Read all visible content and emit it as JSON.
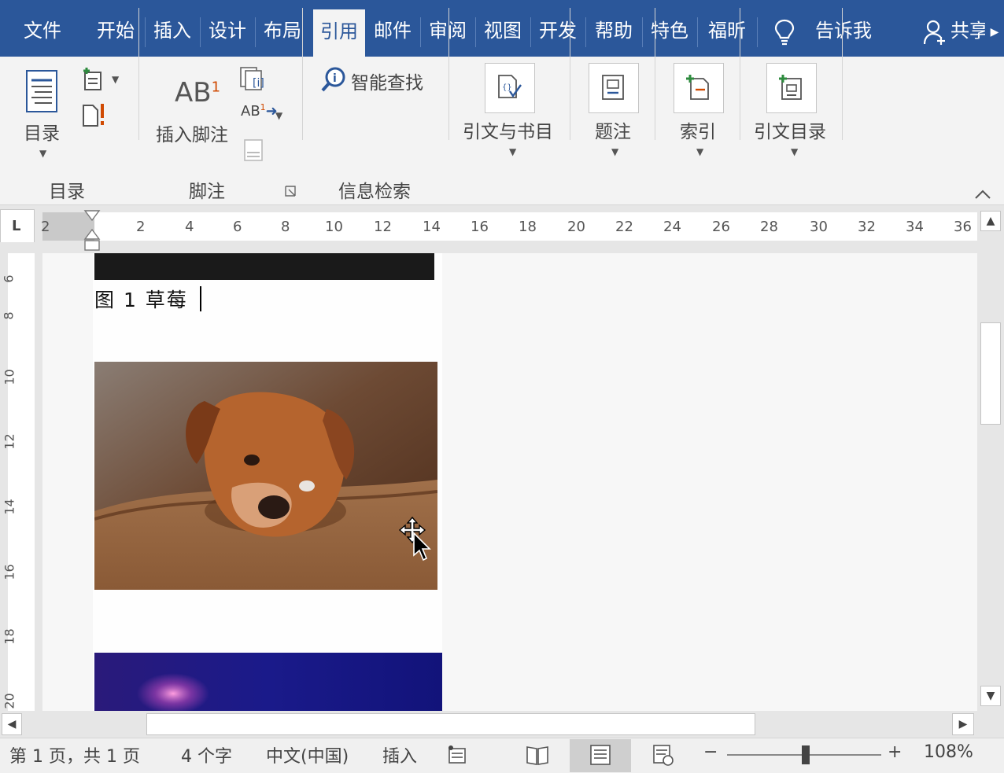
{
  "tabs": [
    {
      "label": "文件",
      "active": false
    },
    {
      "label": "开始",
      "active": false
    },
    {
      "label": "插入",
      "active": false
    },
    {
      "label": "设计",
      "active": false
    },
    {
      "label": "布局",
      "active": false
    },
    {
      "label": "引用",
      "active": true
    },
    {
      "label": "邮件",
      "active": false
    },
    {
      "label": "审阅",
      "active": false
    },
    {
      "label": "视图",
      "active": false
    },
    {
      "label": "开发",
      "active": false
    },
    {
      "label": "帮助",
      "active": false
    },
    {
      "label": "特色",
      "active": false
    },
    {
      "label": "福昕",
      "active": false
    }
  ],
  "tell_me": "告诉我",
  "share": "共享",
  "ribbon": {
    "toc": {
      "button": "目录",
      "group": "目录"
    },
    "footnote": {
      "insert_footnote": "插入脚注",
      "group": "脚注",
      "ab_label": "AB",
      "ab_sup": "1",
      "ab_small": "AB"
    },
    "research": {
      "smart_lookup": "智能查找",
      "group": "信息检索"
    },
    "citations": {
      "button": "引文与书目"
    },
    "captions": {
      "button": "题注"
    },
    "index": {
      "button": "索引"
    },
    "toa": {
      "button": "引文目录"
    }
  },
  "ruler": {
    "corner": "L",
    "h_numbers": [
      "2",
      "2",
      "4",
      "6",
      "8",
      "10",
      "12",
      "14",
      "16",
      "18",
      "20",
      "22",
      "24",
      "26",
      "28",
      "30",
      "32",
      "34",
      "36"
    ],
    "v_numbers": [
      "6",
      "8",
      "10",
      "12",
      "14",
      "16",
      "18",
      "20"
    ]
  },
  "document": {
    "caption": "图 1 草莓"
  },
  "status": {
    "page": "第 1 页，共 1 页",
    "words": "4 个字",
    "language": "中文(中国)",
    "mode": "插入",
    "zoom": "108%",
    "zoom_minus": "−",
    "zoom_plus": "+"
  },
  "colors": {
    "accent": "#2b579a",
    "ribbon_bg": "#f3f3f3",
    "status_bg": "#f0f0f0"
  }
}
